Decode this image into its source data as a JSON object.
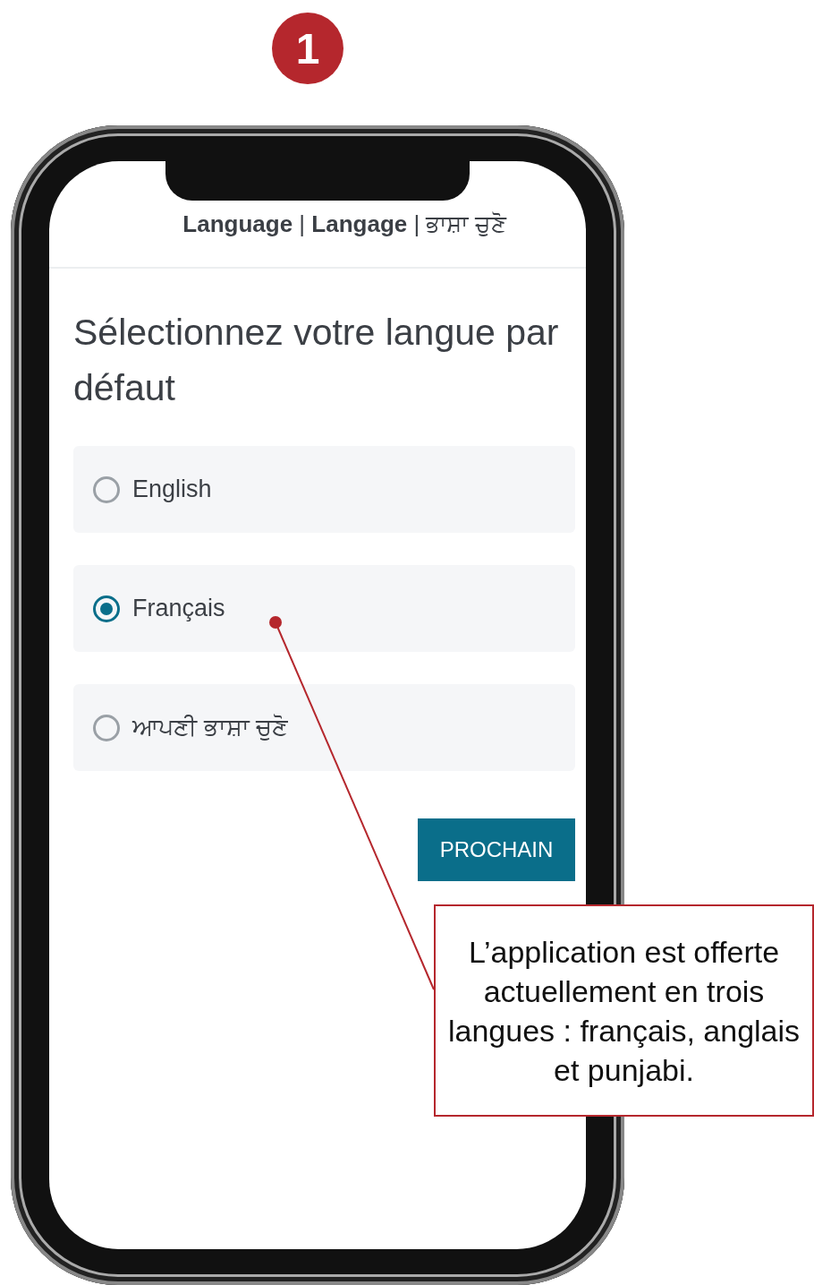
{
  "step_badge": "1",
  "header": {
    "title": "**Language** | **Langage** | ਭਾਸ਼ਾ ਚੁਣੋ"
  },
  "heading": "Sélectionnez votre langue par défaut",
  "options": [
    {
      "label": "English",
      "selected": false
    },
    {
      "label": "Français",
      "selected": true
    },
    {
      "label": "ਆਪਣੀ ਭਾਸ਼ਾ ਚੁਣੋ",
      "selected": false
    }
  ],
  "next_button": "PROCHAIN",
  "callout": "L’application est offerte actuellement en trois langues : français, anglais et punjabi."
}
